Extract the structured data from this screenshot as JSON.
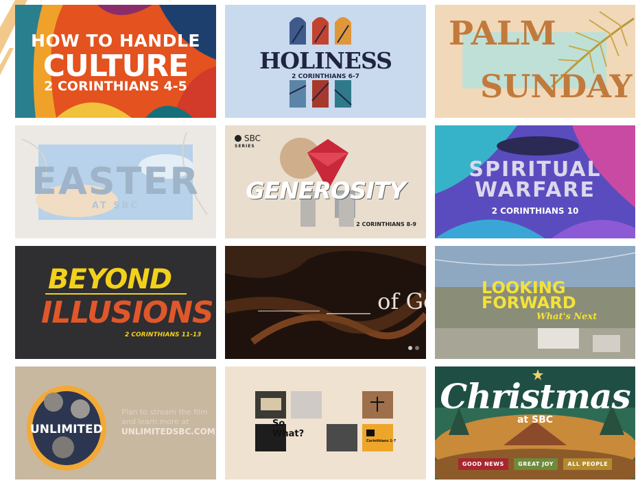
{
  "colors": {
    "background": "#ffffff",
    "deco": "#f3c98b"
  },
  "tiles": [
    {
      "title": "HOW TO HANDLE",
      "title2": "CULTURE",
      "subtitle": "2 CORINTHIANS 4-5"
    },
    {
      "title": "HOLINESS",
      "subtitle": "2 CORINTHIANS 6-7"
    },
    {
      "title": "PALM",
      "title2": "SUNDAY"
    },
    {
      "title": "EASTER",
      "subtitle": "AT SBC"
    },
    {
      "badge": "SBC",
      "badge_sub": "SERIES",
      "title": "GENEROSITY",
      "subtitle": "2 CORINTHIANS 8-9"
    },
    {
      "title": "SPIRITUAL WARFARE",
      "subtitle": "2 CORINTHIANS 10"
    },
    {
      "title": "BEYOND",
      "title2": "ILLUSIONS",
      "subtitle": "2 CORINTHIANS 11-13"
    },
    {
      "title": "____ of God"
    },
    {
      "title": "LOOKING FORWARD",
      "subtitle": "What's Next"
    },
    {
      "title": "UNLIMITED",
      "line1": "Plan to stream the film",
      "line2": "and learn more at",
      "url": "UNLIMITEDSBC.COM"
    },
    {
      "title": "So What?",
      "subtitle": "Corinthians 1-7"
    },
    {
      "title": "Christmas",
      "subtitle": "at SBC",
      "tags": [
        "GOOD NEWS",
        "GREAT JOY",
        "ALL PEOPLE"
      ]
    }
  ]
}
